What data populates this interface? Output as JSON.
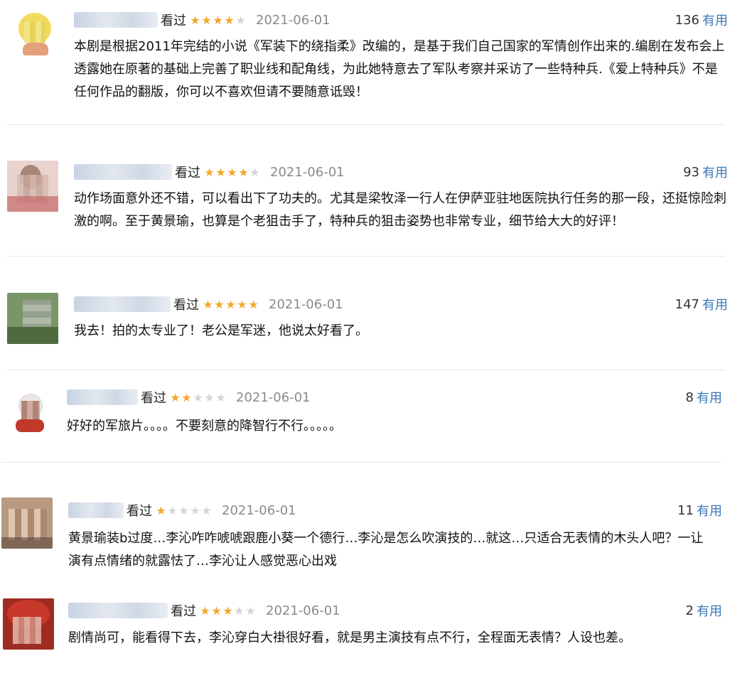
{
  "reviews": [
    {
      "user_label": "看过",
      "stars": 4,
      "date": "2021-06-01",
      "votes": "136",
      "useful_label": "有用",
      "text": "本剧是根据2011年完结的小说《军装下的绕指柔》改编的，是基于我们自己国家的军情创作出来的.编剧在发布会上透露她在原著的基础上完善了职业线和配角线，为此她特意去了军队考察并采访了一些特种兵.《爱上特种兵》不是任何作品的翻版，你可以不喜欢但请不要随意诋毁！",
      "avatar_colors": [
        "#f4e27a",
        "#f1d45a",
        "#e8b07a"
      ]
    },
    {
      "user_label": "看过",
      "stars": 4,
      "date": "2021-06-01",
      "votes": "93",
      "useful_label": "有用",
      "text": "动作场面意外还不错，可以看出下了功夫的。尤其是梁牧泽一行人在伊萨亚驻地医院执行任务的那一段，还挺惊险刺激的啊。至于黄景瑜，也算是个老狙击手了，特种兵的狙击姿势也非常专业，细节给大大的好评！",
      "avatar_colors": [
        "#e8c9c3",
        "#c9a197",
        "#b85c5c"
      ]
    },
    {
      "user_label": "看过",
      "stars": 5,
      "date": "2021-06-01",
      "votes": "147",
      "useful_label": "有用",
      "text": "我去！拍的太专业了！老公是军迷，他说太好看了。",
      "avatar_colors": [
        "#7d9b6a",
        "#5e7a4d",
        "#b0b7a8"
      ]
    },
    {
      "user_label": "看过",
      "stars": 2,
      "date": "2021-06-01",
      "votes": "8",
      "useful_label": "有用",
      "text": "好好的军旅片。。。。不要刻意的降智行不行。。。。。",
      "avatar_colors": [
        "#f4f4f4",
        "#a66a5c",
        "#c23a3a"
      ]
    },
    {
      "user_label": "看过",
      "stars": 1,
      "date": "2021-06-01",
      "votes": "11",
      "useful_label": "有用",
      "text": "黄景瑜装b过度…李沁咋咋唬唬跟鹿小葵一个德行…李沁是怎么吹演技的…就这…只适合无表情的木头人吧？一让演有点情绪的就露怯了…李沁让人感觉恶心出戏",
      "avatar_colors": [
        "#c7a88a",
        "#8a6a55",
        "#e6d2bf"
      ]
    },
    {
      "user_label": "看过",
      "stars": 3,
      "date": "2021-06-01",
      "votes": "2",
      "useful_label": "有用",
      "text": "剧情尚可，能看得下去，李沁穿白大褂很好看，就是男主演技有点不行，全程面无表情？人设也差。",
      "avatar_colors": [
        "#c8392b",
        "#8e2a20",
        "#e3b2a8"
      ]
    }
  ]
}
